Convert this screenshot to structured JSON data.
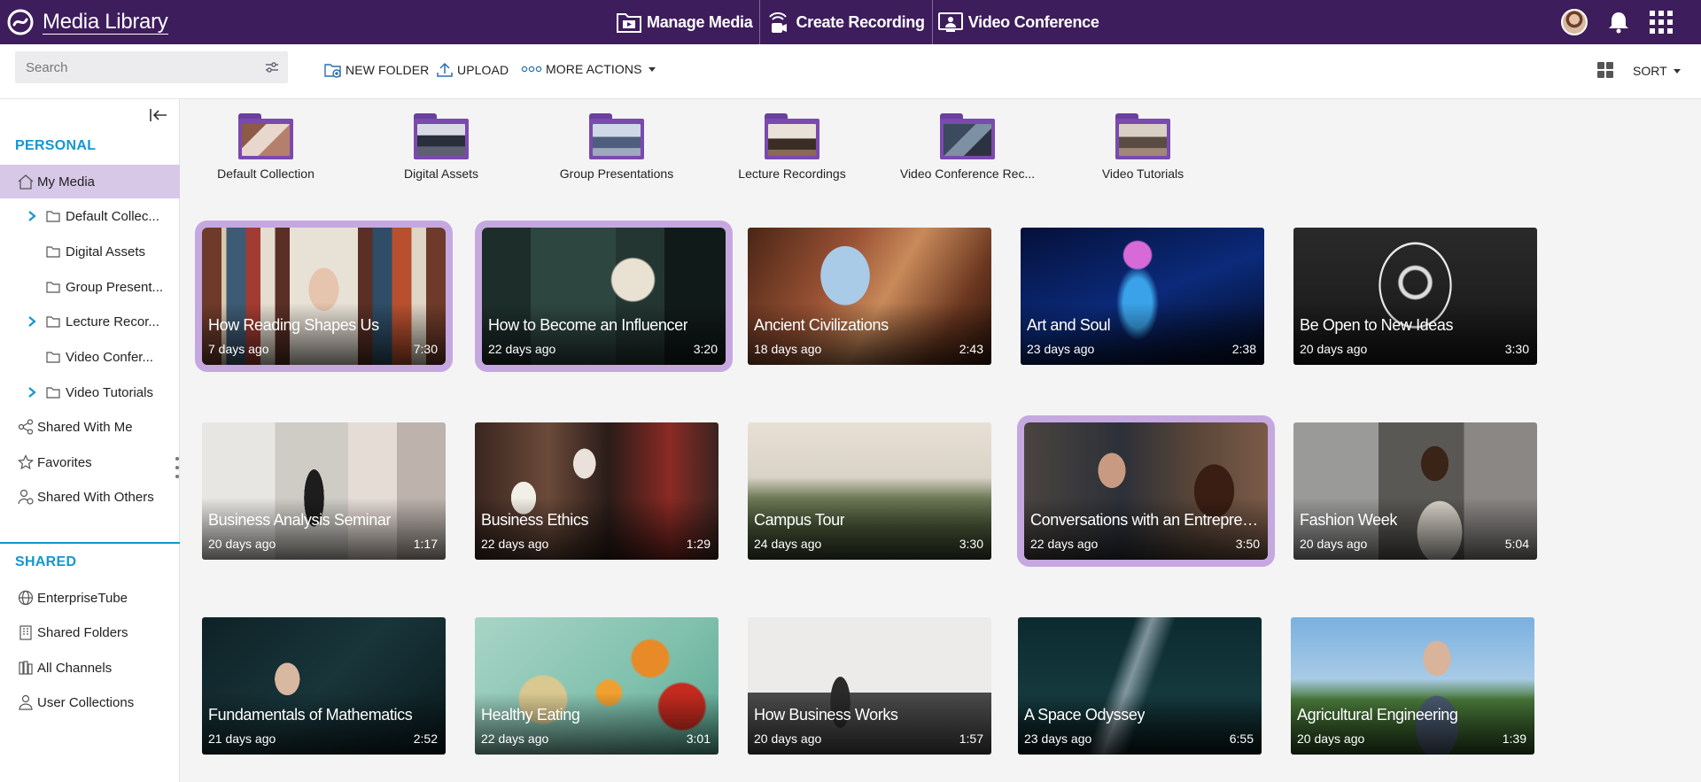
{
  "app": {
    "title": "Media Library",
    "nav": [
      {
        "label": "Manage Media",
        "icon": "film-folder-icon"
      },
      {
        "label": "Create Recording",
        "icon": "broadcast-camera-icon"
      },
      {
        "label": "Video Conference",
        "icon": "video-conference-icon"
      }
    ]
  },
  "toolbar": {
    "search_placeholder": "Search",
    "new_folder": "NEW FOLDER",
    "upload": "UPLOAD",
    "more_actions": "MORE ACTIONS",
    "sort": "SORT"
  },
  "sidebar": {
    "personal_title": "PERSONAL",
    "my_media": "My Media",
    "folders": [
      {
        "label": "Default Collec...",
        "expandable": true
      },
      {
        "label": "Digital Assets",
        "expandable": false
      },
      {
        "label": "Group Present...",
        "expandable": false
      },
      {
        "label": "Lecture Recor...",
        "expandable": true
      },
      {
        "label": "Video Confer...",
        "expandable": false
      },
      {
        "label": "Video Tutorials",
        "expandable": true
      }
    ],
    "shared_with_me": "Shared With Me",
    "favorites": "Favorites",
    "shared_with_others": "Shared With Others",
    "shared_title": "SHARED",
    "shared_items": [
      "EnterpriseTube",
      "Shared Folders",
      "All Channels",
      "User Collections"
    ]
  },
  "folders": [
    {
      "name": "Default Collection"
    },
    {
      "name": "Digital Assets"
    },
    {
      "name": "Group Presentations"
    },
    {
      "name": "Lecture Recordings"
    },
    {
      "name": "Video Conference Rec..."
    },
    {
      "name": "Video Tutorials"
    }
  ],
  "media": [
    {
      "title": "How Reading Shapes Us",
      "age": "7 days ago",
      "duration": "7:30",
      "selected": true
    },
    {
      "title": "How to Become an Influencer",
      "age": "22 days ago",
      "duration": "3:20",
      "selected": true
    },
    {
      "title": "Ancient Civilizations",
      "age": "18 days ago",
      "duration": "2:43",
      "selected": false
    },
    {
      "title": "Art and Soul",
      "age": "23 days ago",
      "duration": "2:38",
      "selected": false
    },
    {
      "title": "Be Open to New Ideas",
      "age": "20 days ago",
      "duration": "3:30",
      "selected": false
    },
    {
      "title": "Business Analysis Seminar",
      "age": "20 days ago",
      "duration": "1:17",
      "selected": false
    },
    {
      "title": "Business Ethics",
      "age": "22 days ago",
      "duration": "1:29",
      "selected": false
    },
    {
      "title": "Campus Tour",
      "age": "24 days ago",
      "duration": "3:30",
      "selected": false
    },
    {
      "title": "Conversations with an Entrepreneur",
      "age": "22 days ago",
      "duration": "3:50",
      "selected": true
    },
    {
      "title": "Fashion Week",
      "age": "20 days ago",
      "duration": "5:04",
      "selected": false
    },
    {
      "title": "Fundamentals of Mathematics",
      "age": "21 days ago",
      "duration": "2:52",
      "selected": false
    },
    {
      "title": "Healthy Eating",
      "age": "22 days ago",
      "duration": "3:01",
      "selected": false
    },
    {
      "title": "How Business Works",
      "age": "20 days ago",
      "duration": "1:57",
      "selected": false
    },
    {
      "title": "A Space Odyssey",
      "age": "23 days ago",
      "duration": "6:55",
      "selected": false
    },
    {
      "title": "Agricultural Engineering",
      "age": "20 days ago",
      "duration": "1:39",
      "selected": false
    }
  ],
  "colors": {
    "topbar": "#3d1d5c",
    "accent_blue": "#1496d2",
    "selection": "#c6a8e0",
    "active_nav": "#d6c8e6"
  }
}
